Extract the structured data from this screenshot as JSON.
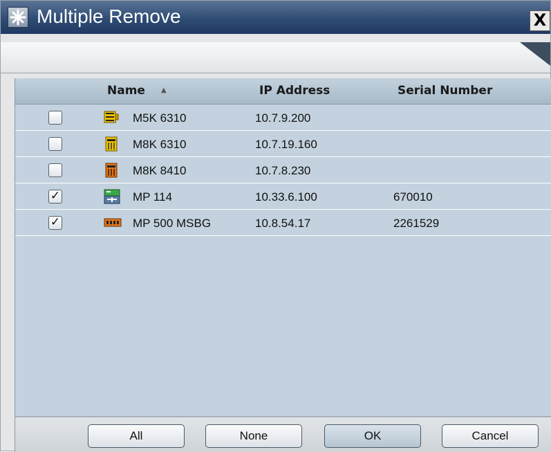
{
  "window": {
    "title": "Multiple Remove",
    "close_label": "X"
  },
  "table": {
    "columns": {
      "name": "Name",
      "ip": "IP Address",
      "serial": "Serial Number",
      "sort_indicator": "▲"
    },
    "check_mark": "✓",
    "rows": [
      {
        "checked": false,
        "name": "M5K 6310",
        "ip": "10.7.9.200",
        "serial": "",
        "icon": "yellow-rack-device-icon"
      },
      {
        "checked": false,
        "name": "M8K 6310",
        "ip": "10.7.19.160",
        "serial": "",
        "icon": "yellow-chassis-device-icon"
      },
      {
        "checked": false,
        "name": "M8K 8410",
        "ip": "10.7.8.230",
        "serial": "",
        "icon": "orange-chassis-device-icon"
      },
      {
        "checked": true,
        "name": "MP 114",
        "ip": "10.33.6.100",
        "serial": "670010",
        "icon": "green-gateway-device-icon"
      },
      {
        "checked": true,
        "name": "MP 500 MSBG",
        "ip": "10.8.54.17",
        "serial": "2261529",
        "icon": "orange-router-device-icon"
      }
    ]
  },
  "buttons": {
    "all": "All",
    "none": "None",
    "ok": "OK",
    "cancel": "Cancel"
  },
  "colors": {
    "title_bar": "#2f4c74",
    "table_background": "#c3d2de",
    "yellow_device": "#f2c400",
    "orange_device": "#e0761c",
    "green_device": "#3aa84a"
  }
}
